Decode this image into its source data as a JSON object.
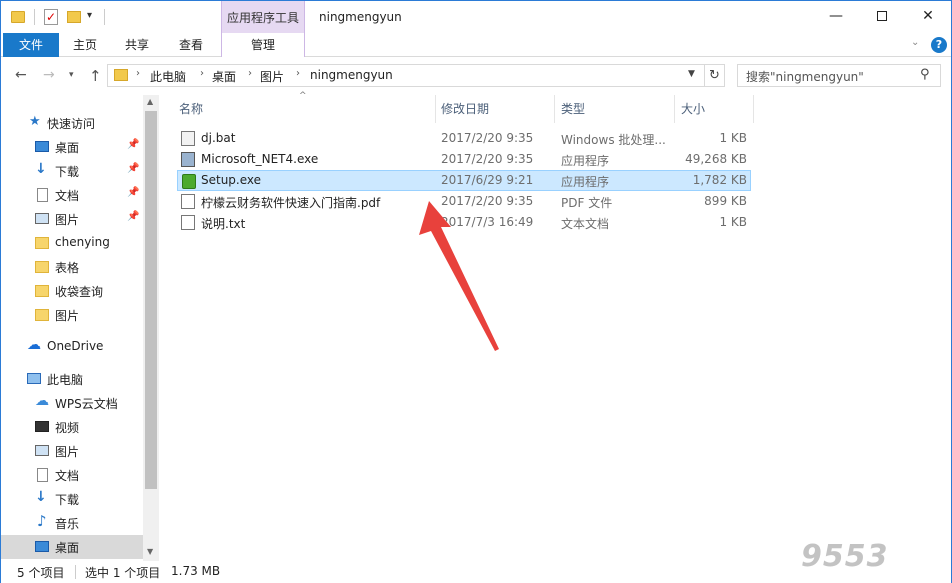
{
  "window": {
    "title": "ningmengyun",
    "tools_tab": "应用程序工具",
    "controls": {
      "minimize": "—",
      "close": "✕"
    }
  },
  "ribbon": {
    "tabs": [
      "文件",
      "主页",
      "共享",
      "查看",
      "管理"
    ],
    "help": "?"
  },
  "address": {
    "segments": [
      "此电脑",
      "桌面",
      "图片",
      "ningmengyun"
    ],
    "search_placeholder": "搜索\"ningmengyun\""
  },
  "sidebar": {
    "quick_access": "快速访问",
    "items": [
      {
        "label": "快速访问"
      },
      {
        "label": "桌面"
      },
      {
        "label": "下载"
      },
      {
        "label": "文档"
      },
      {
        "label": "图片"
      },
      {
        "label": "chenying"
      },
      {
        "label": "表格"
      },
      {
        "label": "收袋查询"
      },
      {
        "label": "图片"
      },
      {
        "label": "OneDrive"
      },
      {
        "label": "此电脑"
      },
      {
        "label": "WPS云文档"
      },
      {
        "label": "视频"
      },
      {
        "label": "图片"
      },
      {
        "label": "文档"
      },
      {
        "label": "下载"
      },
      {
        "label": "音乐"
      },
      {
        "label": "桌面"
      }
    ]
  },
  "columns": {
    "name": "名称",
    "date": "修改日期",
    "type": "类型",
    "size": "大小"
  },
  "files": [
    {
      "name": "dj.bat",
      "date": "2017/2/20 9:35",
      "type": "Windows 批处理...",
      "size": "1 KB"
    },
    {
      "name": "Microsoft_NET4.exe",
      "date": "2017/2/20 9:35",
      "type": "应用程序",
      "size": "49,268 KB"
    },
    {
      "name": "Setup.exe",
      "date": "2017/6/29 9:21",
      "type": "应用程序",
      "size": "1,782 KB"
    },
    {
      "name": "柠檬云财务软件快速入门指南.pdf",
      "date": "2017/2/20 9:35",
      "type": "PDF 文件",
      "size": "899 KB"
    },
    {
      "name": "说明.txt",
      "date": "2017/7/3 16:49",
      "type": "文本文档",
      "size": "1 KB"
    }
  ],
  "status": {
    "count": "5 个项目",
    "selected": "选中 1 个项目",
    "size": "1.73 MB"
  },
  "watermark": "9553",
  "colors": {
    "accent": "#1979ca",
    "selection": "#cce8ff",
    "tools_tab": "#e6d9f2",
    "arrow": "#e8413c"
  }
}
